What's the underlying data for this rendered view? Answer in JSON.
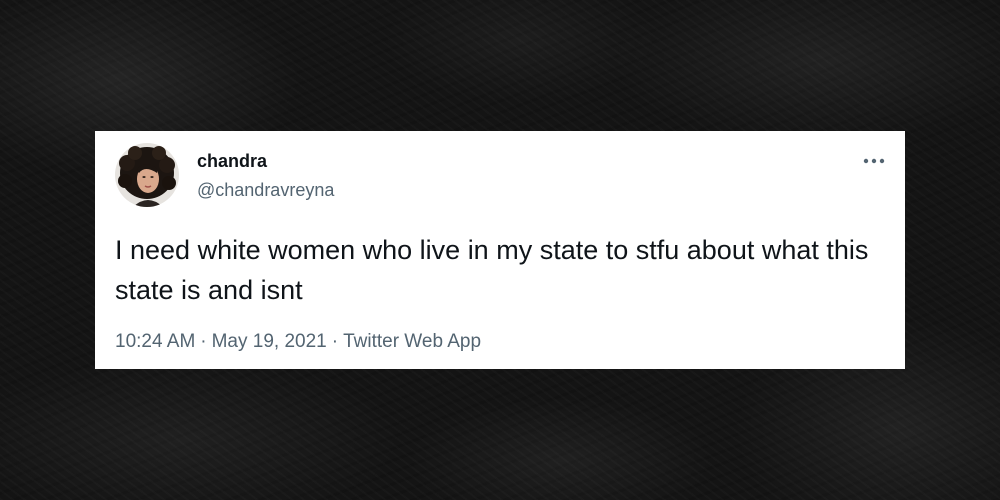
{
  "tweet": {
    "display_name": "chandra",
    "handle": "@chandravreyna",
    "text": "I need white women who live in my state to stfu about what this state is and isnt",
    "time": "10:24 AM",
    "date": "May 19, 2021",
    "source": "Twitter Web App",
    "separator": "·",
    "more_icon": "more-horizontal-icon"
  },
  "colors": {
    "background": "#141414",
    "card": "#ffffff",
    "primary_text": "#0f1419",
    "secondary_text": "#536471"
  }
}
